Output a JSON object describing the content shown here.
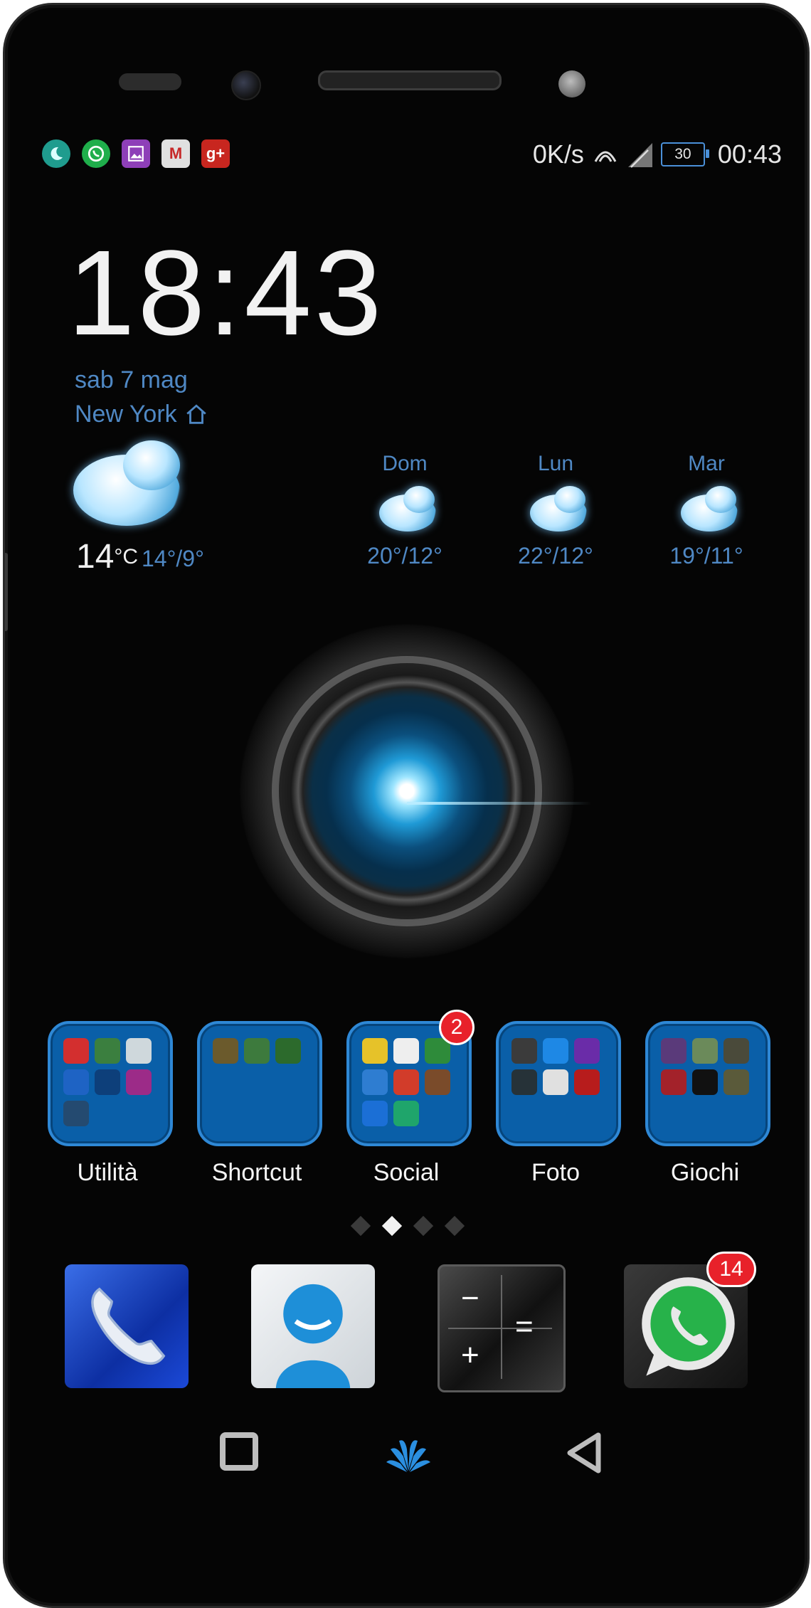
{
  "status_bar": {
    "notifications": [
      "moon-app-icon",
      "whatsapp-icon",
      "gallery-icon",
      "gmail-icon",
      "google-plus-icon"
    ],
    "google_plus_text": "g+",
    "gmail_text": "M",
    "network_speed": "0K/s",
    "battery_level": "30",
    "time": "00:43"
  },
  "clock_widget": {
    "time": "18:43",
    "date": "sab 7 mag",
    "city": "New York"
  },
  "weather": {
    "current_temp": "14",
    "unit": "°C",
    "range": "14°/9°",
    "forecast": [
      {
        "day": "Dom",
        "range": "20°/12°"
      },
      {
        "day": "Lun",
        "range": "22°/12°"
      },
      {
        "day": "Mar",
        "range": "19°/11°"
      }
    ]
  },
  "folders": [
    {
      "label": "Utilità",
      "badge": ""
    },
    {
      "label": "Shortcut",
      "badge": ""
    },
    {
      "label": "Social",
      "badge": "2"
    },
    {
      "label": "Foto",
      "badge": ""
    },
    {
      "label": "Giochi",
      "badge": ""
    }
  ],
  "page_indicator": {
    "pages": 4,
    "active": 2
  },
  "dock": {
    "phone": "phone-icon",
    "contacts": "contacts-icon",
    "calculator": "calculator-icon",
    "whatsapp": "whatsapp-icon",
    "whatsapp_badge": "14",
    "calc_minus": "−",
    "calc_equals": "=",
    "calc_plus": "+"
  },
  "colors": {
    "accent_text": "#4f88c4",
    "folder_fill": "#0a5fa8",
    "badge": "#e8212a"
  }
}
